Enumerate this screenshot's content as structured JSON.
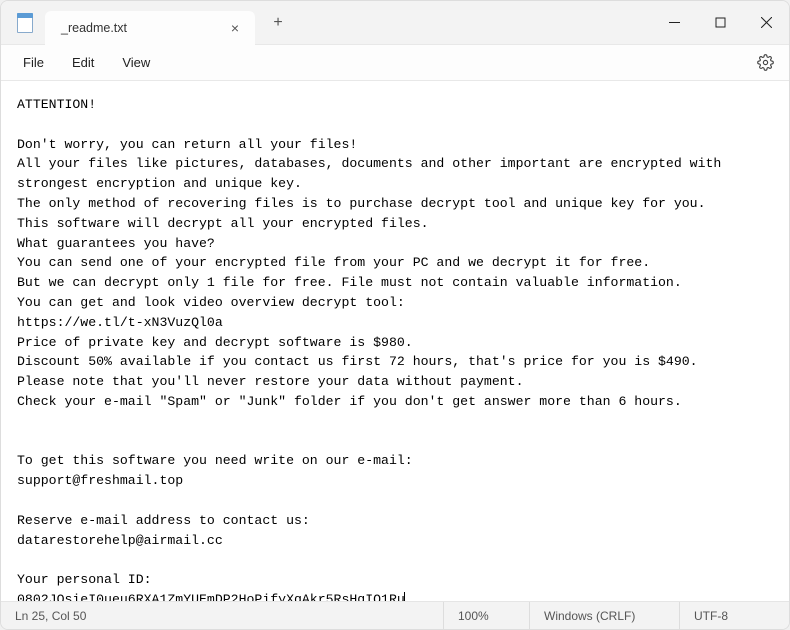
{
  "titlebar": {
    "tab_title": "_readme.txt",
    "new_tab_label": "+",
    "close_tab_label": "×"
  },
  "menubar": {
    "file": "File",
    "edit": "Edit",
    "view": "View"
  },
  "content": {
    "body": "ATTENTION!\n\nDon't worry, you can return all your files!\nAll your files like pictures, databases, documents and other important are encrypted with strongest encryption and unique key.\nThe only method of recovering files is to purchase decrypt tool and unique key for you.\nThis software will decrypt all your encrypted files.\nWhat guarantees you have?\nYou can send one of your encrypted file from your PC and we decrypt it for free.\nBut we can decrypt only 1 file for free. File must not contain valuable information.\nYou can get and look video overview decrypt tool:\nhttps://we.tl/t-xN3VuzQl0a\nPrice of private key and decrypt software is $980.\nDiscount 50% available if you contact us first 72 hours, that's price for you is $490.\nPlease note that you'll never restore your data without payment.\nCheck your e-mail \"Spam\" or \"Junk\" folder if you don't get answer more than 6 hours.\n\n\nTo get this software you need write on our e-mail:\nsupport@freshmail.top\n\nReserve e-mail address to contact us:\ndatarestorehelp@airmail.cc\n\nYour personal ID:\n0802JOsieI0ueu6RXA1ZmYUEmDP2HoPifyXqAkr5RsHqIQ1Ru"
  },
  "statusbar": {
    "position": "Ln 25, Col 50",
    "zoom": "100%",
    "line_ending": "Windows (CRLF)",
    "encoding": "UTF-8"
  }
}
